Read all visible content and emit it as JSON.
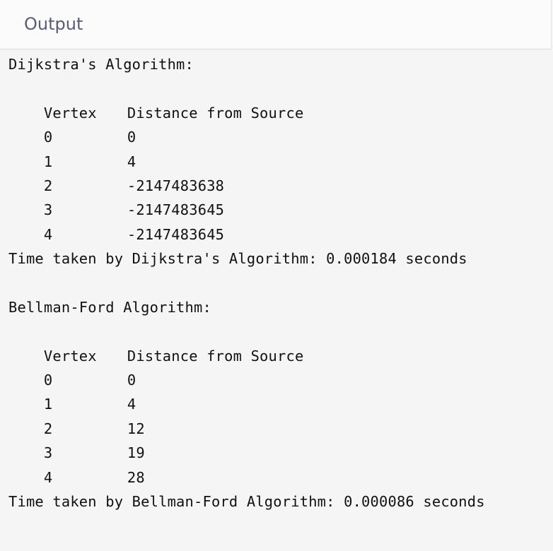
{
  "header": {
    "title": "Output"
  },
  "dijkstra": {
    "title": "Dijkstra's Algorithm:",
    "header_vertex": "Vertex",
    "header_distance": "Distance from Source",
    "rows": [
      {
        "vertex": "0",
        "distance": "0"
      },
      {
        "vertex": "1",
        "distance": "4"
      },
      {
        "vertex": "2",
        "distance": "-2147483638"
      },
      {
        "vertex": "3",
        "distance": "-2147483645"
      },
      {
        "vertex": "4",
        "distance": "-2147483645"
      }
    ],
    "time_line": "Time taken by Dijkstra's Algorithm: 0.000184 seconds"
  },
  "bellman_ford": {
    "title": "Bellman-Ford Algorithm:",
    "header_vertex": "Vertex",
    "header_distance": "Distance from Source",
    "rows": [
      {
        "vertex": "0",
        "distance": "0"
      },
      {
        "vertex": "1",
        "distance": "4"
      },
      {
        "vertex": "2",
        "distance": "12"
      },
      {
        "vertex": "3",
        "distance": "19"
      },
      {
        "vertex": "4",
        "distance": "28"
      }
    ],
    "time_line": "Time taken by Bellman-Ford Algorithm: 0.000086 seconds"
  }
}
